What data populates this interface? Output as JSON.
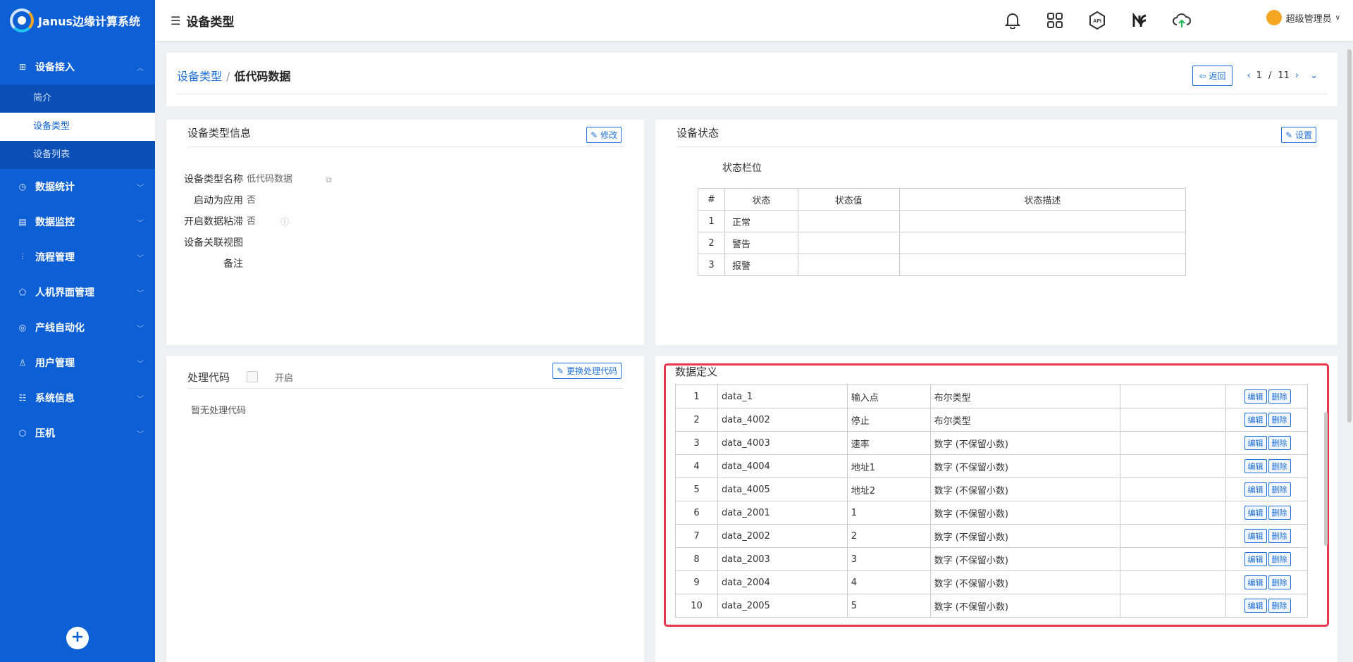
{
  "app": {
    "title": "Janus 边缘计算系统",
    "logo_text": "Janus边缘计算系统"
  },
  "sidebar": {
    "groups": [
      {
        "label": "设备接入",
        "icon": "device-icon",
        "expanded": true,
        "children": [
          {
            "label": "简介"
          },
          {
            "label": "设备类型",
            "active": true
          },
          {
            "label": "设备列表"
          }
        ]
      },
      {
        "label": "数据统计",
        "icon": "clock-icon"
      },
      {
        "label": "数据监控",
        "icon": "monitor-icon"
      },
      {
        "label": "流程管理",
        "icon": "flow-icon"
      },
      {
        "label": "人机界面管理",
        "icon": "hmi-icon"
      },
      {
        "label": "产线自动化",
        "icon": "target-icon"
      },
      {
        "label": "用户管理",
        "icon": "user-icon"
      },
      {
        "label": "系统信息",
        "icon": "settings-icon"
      },
      {
        "label": "压机",
        "icon": "cube-icon"
      }
    ],
    "add_label": "+"
  },
  "header": {
    "page_title": "设备类型",
    "icons": [
      "bell-icon",
      "apps-icon",
      "api-icon",
      "nr-icon",
      "cloud-upload-icon"
    ],
    "user_name": "超级管理员"
  },
  "breadcrumb": {
    "parent": "设备类型",
    "separator": "/",
    "current": "低代码数据",
    "back_label": "返回",
    "page_current": "1",
    "page_sep": "/",
    "page_total": "11"
  },
  "info": {
    "title": "设备类型信息",
    "edit_label": "修改",
    "rows": [
      {
        "label": "设备类型名称",
        "value": "低代码数据"
      },
      {
        "label": "启动为应用",
        "value": "否"
      },
      {
        "label": "开启数据粘滞",
        "value": "否"
      },
      {
        "label": "设备关联视图",
        "value": ""
      },
      {
        "label": "备注",
        "value": ""
      }
    ]
  },
  "state": {
    "title": "设备状态",
    "settings_label": "设置",
    "subtitle": "状态栏位",
    "headers": [
      "#",
      "状态",
      "状态值",
      "状态描述"
    ],
    "rows": [
      [
        "1",
        "正常",
        "",
        ""
      ],
      [
        "2",
        "警告",
        "",
        ""
      ],
      [
        "3",
        "报警",
        "",
        ""
      ]
    ]
  },
  "code": {
    "title": "处理代码",
    "toggle_label": "开启",
    "replace_label": "更换处理代码",
    "empty_text": "暂无处理代码"
  },
  "data_def": {
    "title": "数据定义",
    "edit_label": "编辑",
    "delete_label": "删除",
    "rows": [
      [
        "1",
        "data_1",
        "输入点",
        "布尔类型",
        ""
      ],
      [
        "2",
        "data_4002",
        "停止",
        "布尔类型",
        ""
      ],
      [
        "3",
        "data_4003",
        "速率",
        "数字 (不保留小数)",
        ""
      ],
      [
        "4",
        "data_4004",
        "地址1",
        "数字 (不保留小数)",
        ""
      ],
      [
        "5",
        "data_4005",
        "地址2",
        "数字 (不保留小数)",
        ""
      ],
      [
        "6",
        "data_2001",
        "1",
        "数字 (不保留小数)",
        ""
      ],
      [
        "7",
        "data_2002",
        "2",
        "数字 (不保留小数)",
        ""
      ],
      [
        "8",
        "data_2003",
        "3",
        "数字 (不保留小数)",
        ""
      ],
      [
        "9",
        "data_2004",
        "4",
        "数字 (不保留小数)",
        ""
      ],
      [
        "10",
        "data_2005",
        "5",
        "数字 (不保留小数)",
        ""
      ]
    ]
  },
  "colors": {
    "sidebar": "#0d5fd6",
    "accent": "#1e6fd9",
    "highlight": "#e8364f"
  }
}
